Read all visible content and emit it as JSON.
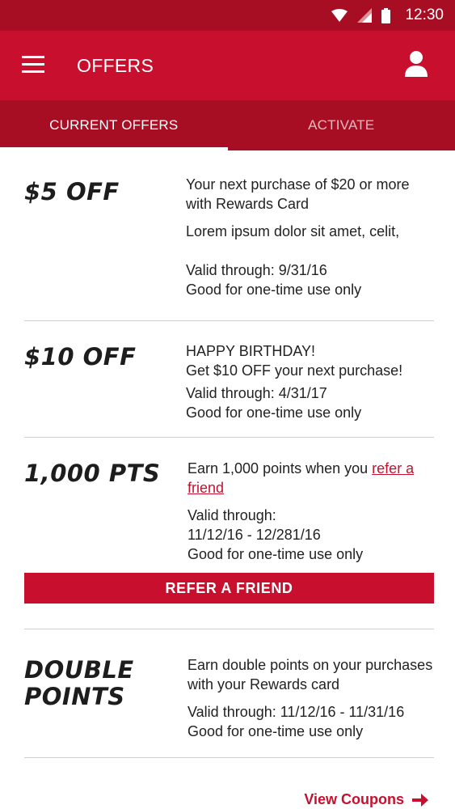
{
  "status_bar": {
    "time": "12:30"
  },
  "app_bar": {
    "title": "OFFERS"
  },
  "tabs": [
    {
      "label": "CURRENT OFFERS",
      "active": true
    },
    {
      "label": "ACTIVATE",
      "active": false
    }
  ],
  "offers": [
    {
      "title": "$5 OFF",
      "line1": "Your next purchase of $20 or more with Rewards Card",
      "line2": "Lorem ipsum dolor sit amet, celit,",
      "valid": "Valid through: 9/31/16",
      "usage": "Good for one-time use only"
    },
    {
      "title": "$10 OFF",
      "line1": "HAPPY BIRTHDAY!",
      "line2": "Get $10 OFF your next purchase!",
      "valid": "Valid through: 4/31/17",
      "usage": "Good for one-time use only"
    },
    {
      "title": "1,000 PTS",
      "line1": "Earn 1,000 points when you",
      "link": "refer a friend",
      "valid_label": "Valid through:",
      "valid_range": "11/12/16 - 12/281/16",
      "usage": "Good for one-time use only",
      "button": "REFER A FRIEND"
    },
    {
      "title_line1": "DOUBLE",
      "title_line2": "POINTS",
      "line1": "Earn double points on your purchases with your Rewards card",
      "valid": "Valid through: 11/12/16 - 11/31/16",
      "usage": "Good for one-time use only"
    }
  ],
  "footer": {
    "view_coupons": "View Coupons"
  },
  "colors": {
    "primary": "#c8102e",
    "primary_dark": "#a80e23"
  }
}
